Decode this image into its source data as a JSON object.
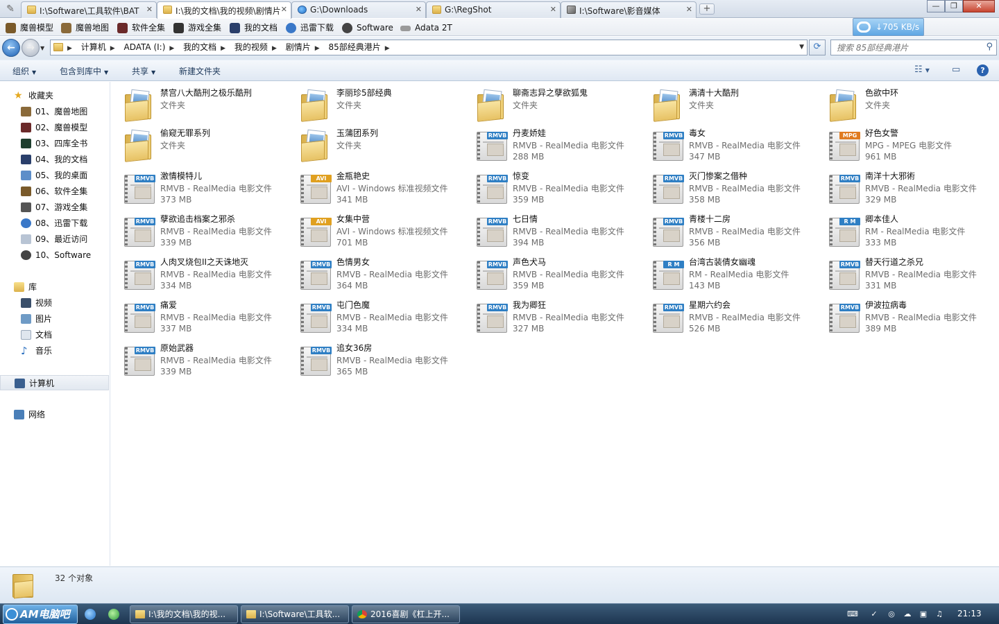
{
  "tabs": [
    {
      "label": "I:\\Software\\工具软件\\BAT",
      "icon": "folder-icon"
    },
    {
      "label": "I:\\我的文档\\我的视频\\剧情片",
      "icon": "folder-icon"
    },
    {
      "label": "G:\\Downloads",
      "icon": "ie-icon"
    },
    {
      "label": "G:\\RegShot",
      "icon": "folder-icon"
    },
    {
      "label": "I:\\Software\\影音媒体",
      "icon": "software-icon"
    }
  ],
  "favorites": [
    {
      "label": "魔兽模型",
      "color": "#7a5a2a"
    },
    {
      "label": "魔兽地图",
      "color": "#8a6a3a"
    },
    {
      "label": "软件全集",
      "color": "#6b2a2a"
    },
    {
      "label": "游戏全集",
      "color": "#333333"
    },
    {
      "label": "我的文档",
      "color": "#2a3f6b"
    },
    {
      "label": "迅雷下载",
      "color": "#3a78c8"
    },
    {
      "label": "Software",
      "color": "#444444"
    },
    {
      "label": "Adata 2T",
      "color": "#9a9a9a"
    }
  ],
  "speed": "705 KB/s",
  "address": {
    "crumbs": [
      "计算机",
      "ADATA (I:)",
      "我的文档",
      "我的视频",
      "剧情片",
      "85部经典港片"
    ],
    "search_placeholder": "搜索 85部经典港片"
  },
  "commands": {
    "organize": "组织",
    "include_library": "包含到库中",
    "share": "共享",
    "new_folder": "新建文件夹"
  },
  "nav": {
    "favorites_header": "收藏夹",
    "favorites": [
      "01、魔兽地图",
      "02、魔兽模型",
      "03、四库全书",
      "04、我的文档",
      "05、我的桌面",
      "06、软件全集",
      "07、游戏全集",
      "08、迅雷下载",
      "09、最近访问",
      "10、Software"
    ],
    "library_header": "库",
    "libraries": [
      "视频",
      "图片",
      "文档",
      "音乐"
    ],
    "computer": "计算机",
    "network": "网络"
  },
  "files": [
    {
      "name": "禁宫八大酷刑之极乐酷刑",
      "type": "文件夹",
      "size": "",
      "kind": "folder"
    },
    {
      "name": "李丽珍5部经典",
      "type": "文件夹",
      "size": "",
      "kind": "folder"
    },
    {
      "name": "聊斋志异之孽欲狐鬼",
      "type": "文件夹",
      "size": "",
      "kind": "folder"
    },
    {
      "name": "满清十大酷刑",
      "type": "文件夹",
      "size": "",
      "kind": "folder"
    },
    {
      "name": "色欲中环",
      "type": "文件夹",
      "size": "",
      "kind": "folder"
    },
    {
      "name": "偷窥无罪系列",
      "type": "文件夹",
      "size": "",
      "kind": "folder"
    },
    {
      "name": "玉蒲团系列",
      "type": "文件夹",
      "size": "",
      "kind": "folder"
    },
    {
      "name": "丹麦娇娃",
      "type": "RMVB - RealMedia 电影文件",
      "size": "288 MB",
      "kind": "RMVB"
    },
    {
      "name": "毒女",
      "type": "RMVB - RealMedia 电影文件",
      "size": "347 MB",
      "kind": "RMVB"
    },
    {
      "name": "好色女警",
      "type": "MPG - MPEG 电影文件",
      "size": "961 MB",
      "kind": "MPG"
    },
    {
      "name": "激情模特儿",
      "type": "RMVB - RealMedia 电影文件",
      "size": "373 MB",
      "kind": "RMVB"
    },
    {
      "name": "金瓶艳史",
      "type": "AVI - Windows 标准视频文件",
      "size": "341 MB",
      "kind": "AVI"
    },
    {
      "name": "惊变",
      "type": "RMVB - RealMedia 电影文件",
      "size": "359 MB",
      "kind": "RMVB"
    },
    {
      "name": "灭门惨案之借种",
      "type": "RMVB - RealMedia 电影文件",
      "size": "358 MB",
      "kind": "RMVB"
    },
    {
      "name": "南洋十大邪術",
      "type": "RMVB - RealMedia 电影文件",
      "size": "329 MB",
      "kind": "RMVB"
    },
    {
      "name": "孽欲追击档案之邪杀",
      "type": "RMVB - RealMedia 电影文件",
      "size": "339 MB",
      "kind": "RMVB"
    },
    {
      "name": "女集中营",
      "type": "AVI - Windows 标准视频文件",
      "size": "701 MB",
      "kind": "AVI"
    },
    {
      "name": "七日情",
      "type": "RMVB - RealMedia 电影文件",
      "size": "394 MB",
      "kind": "RMVB"
    },
    {
      "name": "青楼十二房",
      "type": "RMVB - RealMedia 电影文件",
      "size": "356 MB",
      "kind": "RMVB"
    },
    {
      "name": "卿本佳人",
      "type": "RM - RealMedia 电影文件",
      "size": "333 MB",
      "kind": "R M"
    },
    {
      "name": "人肉叉烧包II之天诛地灭",
      "type": "RMVB - RealMedia 电影文件",
      "size": "334 MB",
      "kind": "RMVB"
    },
    {
      "name": "色情男女",
      "type": "RMVB - RealMedia 电影文件",
      "size": "364 MB",
      "kind": "RMVB"
    },
    {
      "name": "声色犬马",
      "type": "RMVB - RealMedia 电影文件",
      "size": "359 MB",
      "kind": "RMVB"
    },
    {
      "name": "台湾古装倩女幽魂",
      "type": "RM - RealMedia 电影文件",
      "size": "143 MB",
      "kind": "R M"
    },
    {
      "name": "替天行道之杀兄",
      "type": "RMVB - RealMedia 电影文件",
      "size": "331 MB",
      "kind": "RMVB"
    },
    {
      "name": "痛爱",
      "type": "RMVB - RealMedia 电影文件",
      "size": "337 MB",
      "kind": "RMVB"
    },
    {
      "name": "屯门色魔",
      "type": "RMVB - RealMedia 电影文件",
      "size": "334 MB",
      "kind": "RMVB"
    },
    {
      "name": "我为卿狂",
      "type": "RMVB - RealMedia 电影文件",
      "size": "327 MB",
      "kind": "RMVB"
    },
    {
      "name": "星期六约会",
      "type": "RMVB - RealMedia 电影文件",
      "size": "526 MB",
      "kind": "RMVB"
    },
    {
      "name": "伊波拉病毒",
      "type": "RMVB - RealMedia 电影文件",
      "size": "389 MB",
      "kind": "RMVB"
    },
    {
      "name": "原始武器",
      "type": "RMVB - RealMedia 电影文件",
      "size": "339 MB",
      "kind": "RMVB"
    },
    {
      "name": "追女36房",
      "type": "RMVB - RealMedia 电影文件",
      "size": "365 MB",
      "kind": "RMVB"
    }
  ],
  "status": {
    "count": "32 个对象"
  },
  "taskbar": {
    "start_label": "AM电脑吧",
    "tasks": [
      "I:\\我的文档\\我的视...",
      "I:\\Software\\工具软...",
      "2016喜剧《杠上开..."
    ],
    "clock": "21:13"
  },
  "colors": {
    "rmvb_badge": "#2f7fc4",
    "avi_badge": "#e0a020",
    "mpg_badge": "#e07b20",
    "accent": "#1e395b"
  }
}
